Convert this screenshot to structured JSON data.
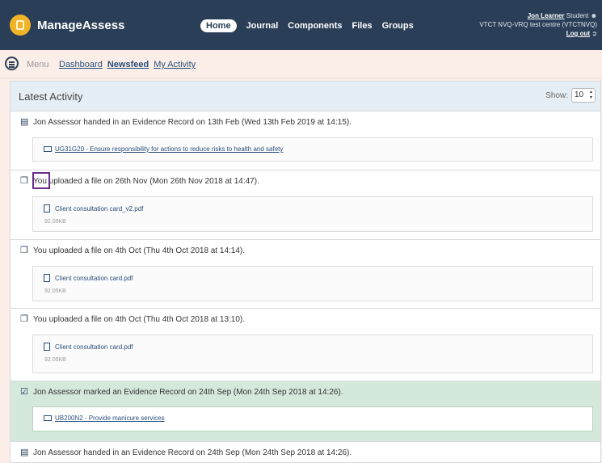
{
  "app": {
    "name": "ManageAssess"
  },
  "nav": {
    "items": [
      "Home",
      "Journal",
      "Components",
      "Files",
      "Groups"
    ]
  },
  "user": {
    "name": "Jon Learner",
    "role": "Student",
    "centre": "VTCT NVQ-VRQ test centre (VTCTNVQ)",
    "logout": "Log out"
  },
  "subnav": {
    "menu_label": "Menu",
    "links": [
      "Dashboard",
      "Newsfeed",
      "My Activity"
    ],
    "active": "Newsfeed"
  },
  "activity": {
    "title": "Latest Activity",
    "show_label": "Show:",
    "show_value": "10",
    "items": [
      {
        "icon": "inbox-icon",
        "text": "Jon Assessor handed in an Evidence Record on 13th Feb (Wed 13th Feb 2019 at 14:15).",
        "link": "UG31G20 - Ensure responsibility for actions to reduce risks to health and safety"
      },
      {
        "icon": "files-icon",
        "text": "You uploaded a file on 26th Nov (Mon 26th Nov 2018 at 14:47).",
        "file": "Client consultation card_v2.pdf",
        "size": "92.05KB"
      },
      {
        "icon": "files-icon",
        "text": "You uploaded a file on 4th Oct (Thu 4th Oct 2018 at 14:14).",
        "file": "Client consultation card.pdf",
        "size": "92.05KB"
      },
      {
        "icon": "files-icon",
        "text": "You uploaded a file on 4th Oct (Thu 4th Oct 2018 at 13:10).",
        "file": "Client consultation card.pdf",
        "size": "92.05KB"
      },
      {
        "icon": "check-icon",
        "text": "Jon Assessor marked an Evidence Record on 24th Sep (Mon 24th Sep 2018 at 14:26).",
        "link": "UB200N2 - Provide manicure services"
      },
      {
        "icon": "inbox-icon",
        "text": "Jon Assessor handed in an Evidence Record on 24th Sep (Mon 24th Sep 2018 at 14:26)."
      }
    ]
  }
}
